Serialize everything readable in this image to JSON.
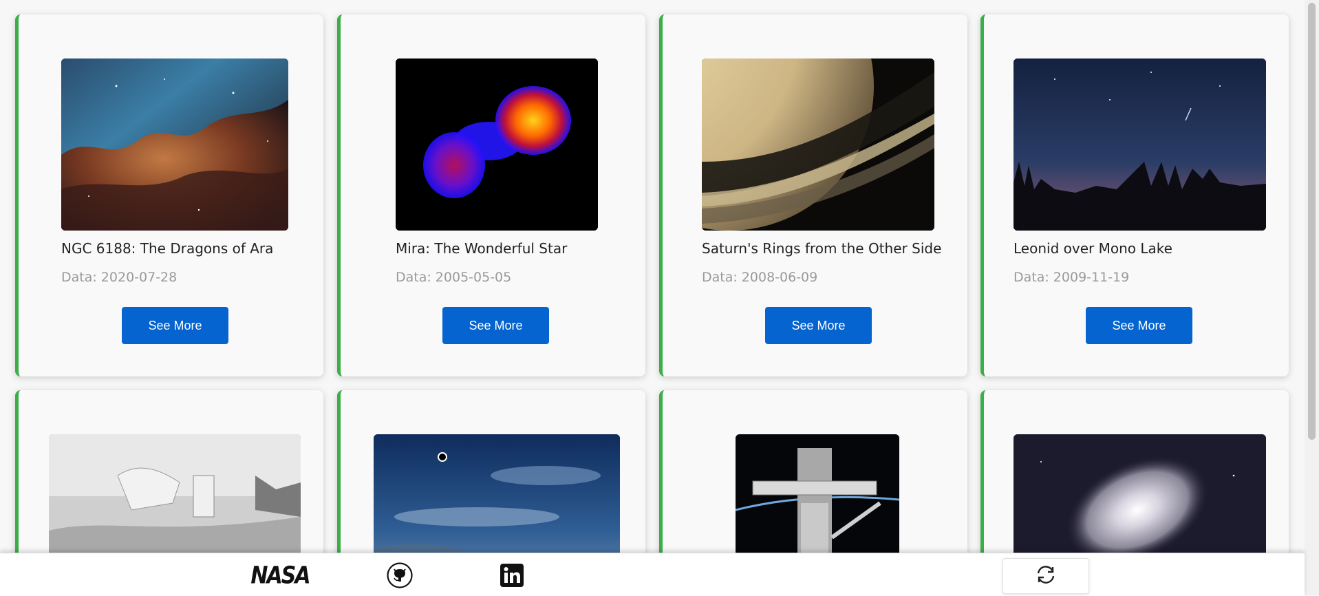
{
  "cards": [
    {
      "title": "NGC 6188: The Dragons of Ara",
      "date": "Data: 2020-07-28",
      "button": "See More",
      "image": "nebula-image"
    },
    {
      "title": "Mira: The Wonderful Star",
      "date": "Data: 2005-05-05",
      "button": "See More",
      "image": "mira-star-image"
    },
    {
      "title": "Saturn's Rings from the Other Side",
      "date": "Data: 2008-06-09",
      "button": "See More",
      "image": "saturn-rings-image"
    },
    {
      "title": "Leonid over Mono Lake",
      "date": "Data: 2009-11-19",
      "button": "See More",
      "image": "mono-lake-image"
    },
    {
      "image": "mars-lander-image"
    },
    {
      "image": "eclipse-sky-image"
    },
    {
      "image": "hubble-telescope-image"
    },
    {
      "image": "galaxy-image"
    }
  ],
  "footer": {
    "nasa_logo": "NASA",
    "icons": [
      "nasa-logo-icon",
      "github-icon",
      "linkedin-icon",
      "refresh-icon"
    ]
  },
  "colors": {
    "accent_border": "#3cae48",
    "button_bg": "#0564cf",
    "button_text": "#ffffff",
    "date_text": "#9a9a9a"
  }
}
